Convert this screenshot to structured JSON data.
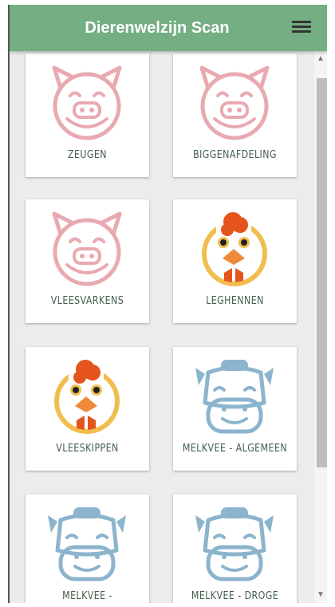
{
  "header": {
    "title": "Dierenwelzijn Scan",
    "menu_icon": "hamburger-menu-icon"
  },
  "tiles": [
    {
      "label": "ZEUGEN",
      "icon": "pig-icon"
    },
    {
      "label": "BIGGENAFDELING",
      "icon": "pig-icon"
    },
    {
      "label": "VLEESVARKENS",
      "icon": "pig-icon"
    },
    {
      "label": "LEGHENNEN",
      "icon": "chicken-icon"
    },
    {
      "label": "VLEESKIPPEN",
      "icon": "chicken-icon"
    },
    {
      "label": "MELKVEE - ALGEMEEN",
      "icon": "cow-icon"
    },
    {
      "label": "MELKVEE - MELKKOEIEN",
      "icon": "cow-icon"
    },
    {
      "label": "MELKVEE - DROGE KOEIEN",
      "icon": "cow-icon"
    }
  ],
  "colors": {
    "header": "#74ae82",
    "pig": "#e9a9b1",
    "chicken_ring": "#f2bd4f",
    "chicken_comb": "#e5541d",
    "chicken_beak": "#f08a3a",
    "cow": "#8cb4cd",
    "label": "#43604d"
  }
}
